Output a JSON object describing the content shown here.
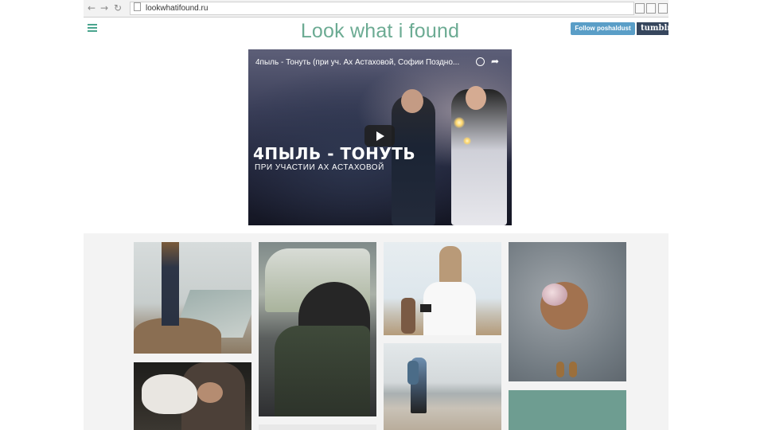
{
  "browser": {
    "url": "lookwhatifound.ru",
    "back_icon": "back-arrow-icon",
    "forward_icon": "forward-arrow-icon",
    "reload_icon": "reload-icon"
  },
  "header": {
    "title": "Look what i found",
    "follow_label": "Follow poshaldust",
    "tumblr_label": "tumblr.",
    "accent_color": "#6cab93",
    "follow_color": "#5a9ec7",
    "tumblr_color": "#36465d"
  },
  "video": {
    "title": "4пыль - Тонуть (при уч. Ах Астаховой, Софии Поздно...",
    "overlay_title": "4ПЫЛЬ - ТОНУТЬ",
    "overlay_subtitle": "ПРИ УЧАСТИИ АХ АСТАХОВОЙ",
    "play_icon": "play-icon",
    "watch_later_icon": "clock-icon",
    "share_icon": "share-icon"
  },
  "grid": {
    "background": "#f3f3f3",
    "tiles": [
      {
        "subject": "person-standing-on-cliff-photo"
      },
      {
        "subject": "person-in-car-photo"
      },
      {
        "subject": "woman-with-camera-photo"
      },
      {
        "subject": "girl-with-flowers-photo"
      },
      {
        "subject": "man-with-dog-photo"
      },
      {
        "subject": "hiker-on-beach-photo"
      },
      {
        "subject": "partial-photo"
      },
      {
        "subject": "teal-tile"
      }
    ]
  }
}
